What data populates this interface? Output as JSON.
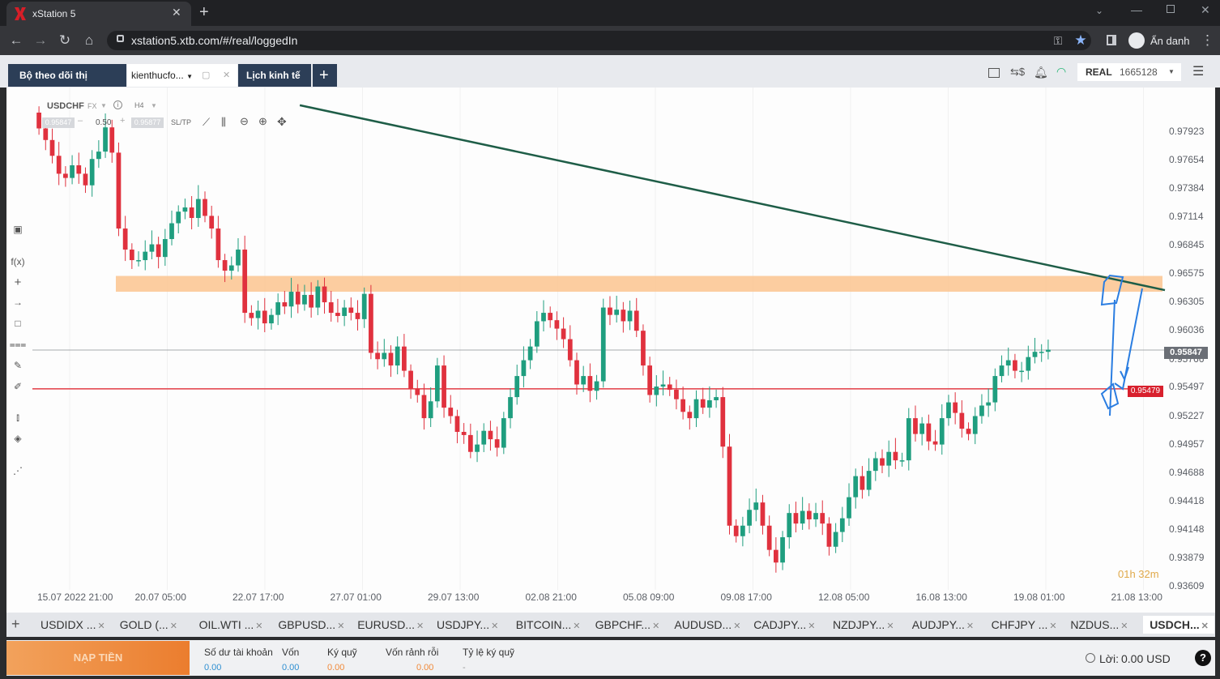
{
  "browser": {
    "tab_title": "xStation 5",
    "url": "xstation5.xtb.com/#/real/loggedIn",
    "profile_label": "Ẩn danh"
  },
  "toolbar": {
    "tab_market": "Bộ theo dõi thị trường",
    "tab_user": "kienthucfo...",
    "tab_calendar": "Lịch kinh tế",
    "account_type": "REAL",
    "account_number": "1665128"
  },
  "chart_header": {
    "symbol": "USDCHF",
    "market": "FX",
    "timeframe": "H4",
    "bid": "0.95847",
    "volume": "0.50",
    "ask": "0.95877",
    "sltp": "SL/TP"
  },
  "chart_data": {
    "type": "candlestick",
    "symbol": "USDCHF",
    "timeframe": "H4",
    "y_ticks": [
      0.97923,
      0.97654,
      0.97384,
      0.97114,
      0.96845,
      0.96575,
      0.96305,
      0.96036,
      0.95766,
      0.95497,
      0.95227,
      0.94957,
      0.94688,
      0.94418,
      0.94148,
      0.93879,
      0.93609
    ],
    "y_tick_labels": [
      "0.97923",
      "0.97654",
      "0.97384",
      "0.97114",
      "0.96845",
      "0.96575",
      "0.96305",
      "0.96036",
      "0.95766",
      "0.95497",
      "0.95227",
      "0.94957",
      "0.94688",
      "0.94418",
      "0.94148",
      "0.93879",
      "0.93609"
    ],
    "x_tick_labels": [
      "15.07 2022 21:00",
      "20.07 05:00",
      "22.07 17:00",
      "27.07 01:00",
      "29.07 13:00",
      "02.08 21:00",
      "05.08 09:00",
      "09.08 17:00",
      "12.08 05:00",
      "16.08 13:00",
      "19.08 01:00",
      "21.08 13:00"
    ],
    "current_price": "0.95847",
    "horizontal_line_price": "0.95479",
    "support_zone": [
      0.964,
      0.9655
    ],
    "trendline": {
      "from": {
        "t": 0.2,
        "price": 0.9817
      },
      "to": {
        "t": 11.2,
        "price": 0.964
      }
    },
    "countdown": "01h 32m",
    "colors": {
      "up": "#1f9e7f",
      "down": "#e0313e",
      "zone": "#fcc48f",
      "trend": "#1e5d47",
      "hline": "#e33c44",
      "annotation": "#2a7de1"
    },
    "closes": [
      0.9795,
      0.9784,
      0.9769,
      0.9752,
      0.9748,
      0.976,
      0.9752,
      0.9741,
      0.9766,
      0.9773,
      0.9796,
      0.9772,
      0.97,
      0.968,
      0.967,
      0.967,
      0.9678,
      0.9685,
      0.9673,
      0.969,
      0.9705,
      0.9716,
      0.972,
      0.971,
      0.9728,
      0.9712,
      0.97,
      0.967,
      0.966,
      0.9665,
      0.968,
      0.962,
      0.9615,
      0.9622,
      0.961,
      0.9618,
      0.963,
      0.9626,
      0.964,
      0.9628,
      0.9637,
      0.9625,
      0.9645,
      0.963,
      0.962,
      0.9617,
      0.9625,
      0.962,
      0.9614,
      0.9638,
      0.9582,
      0.9576,
      0.9582,
      0.957,
      0.9588,
      0.9565,
      0.9548,
      0.9542,
      0.952,
      0.9536,
      0.957,
      0.953,
      0.9522,
      0.9507,
      0.9504,
      0.9488,
      0.9495,
      0.9508,
      0.95,
      0.9492,
      0.952,
      0.954,
      0.956,
      0.9575,
      0.9588,
      0.9612,
      0.962,
      0.9613,
      0.9605,
      0.9595,
      0.9575,
      0.9552,
      0.956,
      0.9546,
      0.9555,
      0.9625,
      0.9618,
      0.9623,
      0.9612,
      0.9622,
      0.9603,
      0.957,
      0.9542,
      0.955,
      0.9552,
      0.9547,
      0.9538,
      0.9526,
      0.952,
      0.9538,
      0.953,
      0.9537,
      0.954,
      0.9493,
      0.9418,
      0.9408,
      0.9418,
      0.9433,
      0.944,
      0.9418,
      0.9395,
      0.9383,
      0.9407,
      0.943,
      0.942,
      0.9432,
      0.9424,
      0.943,
      0.942,
      0.9398,
      0.9412,
      0.9425,
      0.9445,
      0.9465,
      0.9452,
      0.947,
      0.9482,
      0.9475,
      0.9488,
      0.948,
      0.948,
      0.952,
      0.9505,
      0.9515,
      0.9498,
      0.9495,
      0.952,
      0.9535,
      0.9525,
      0.951,
      0.9505,
      0.9522,
      0.9532,
      0.9535,
      0.956,
      0.957,
      0.9575,
      0.9565,
      0.9565,
      0.9578,
      0.9583,
      0.9583,
      0.9585
    ]
  },
  "left_tools": [
    "chart-type",
    "fx",
    "crosshair",
    "line",
    "rect",
    "fibonacci",
    "pen",
    "brush",
    "candle-settings",
    "layers",
    "share"
  ],
  "instruments": [
    {
      "label": "USDIDX ..."
    },
    {
      "label": "GOLD (..."
    },
    {
      "label": "OIL.WTI ..."
    },
    {
      "label": "GBPUSD..."
    },
    {
      "label": "EURUSD..."
    },
    {
      "label": "USDJPY..."
    },
    {
      "label": "BITCOIN..."
    },
    {
      "label": "GBPCHF..."
    },
    {
      "label": "AUDUSD..."
    },
    {
      "label": "CADJPY..."
    },
    {
      "label": "NZDJPY..."
    },
    {
      "label": "AUDJPY..."
    },
    {
      "label": "CHFJPY ..."
    },
    {
      "label": "NZDUS..."
    },
    {
      "label": "USDCH..."
    }
  ],
  "account": {
    "deposit_button": "NẠP TIỀN",
    "balance_label": "Số dư tài khoản",
    "balance_value": "0.00",
    "equity_label": "Vốn",
    "equity_value": "0.00",
    "margin_label": "Ký quỹ",
    "margin_value": "0.00",
    "free_margin_label": "Vốn rảnh rỗi",
    "free_margin_value": "0.00",
    "margin_level_label": "Tỷ lệ ký quỹ",
    "margin_level_value": "-",
    "profit_label": "Lời:",
    "profit_value": "0.00 USD"
  }
}
